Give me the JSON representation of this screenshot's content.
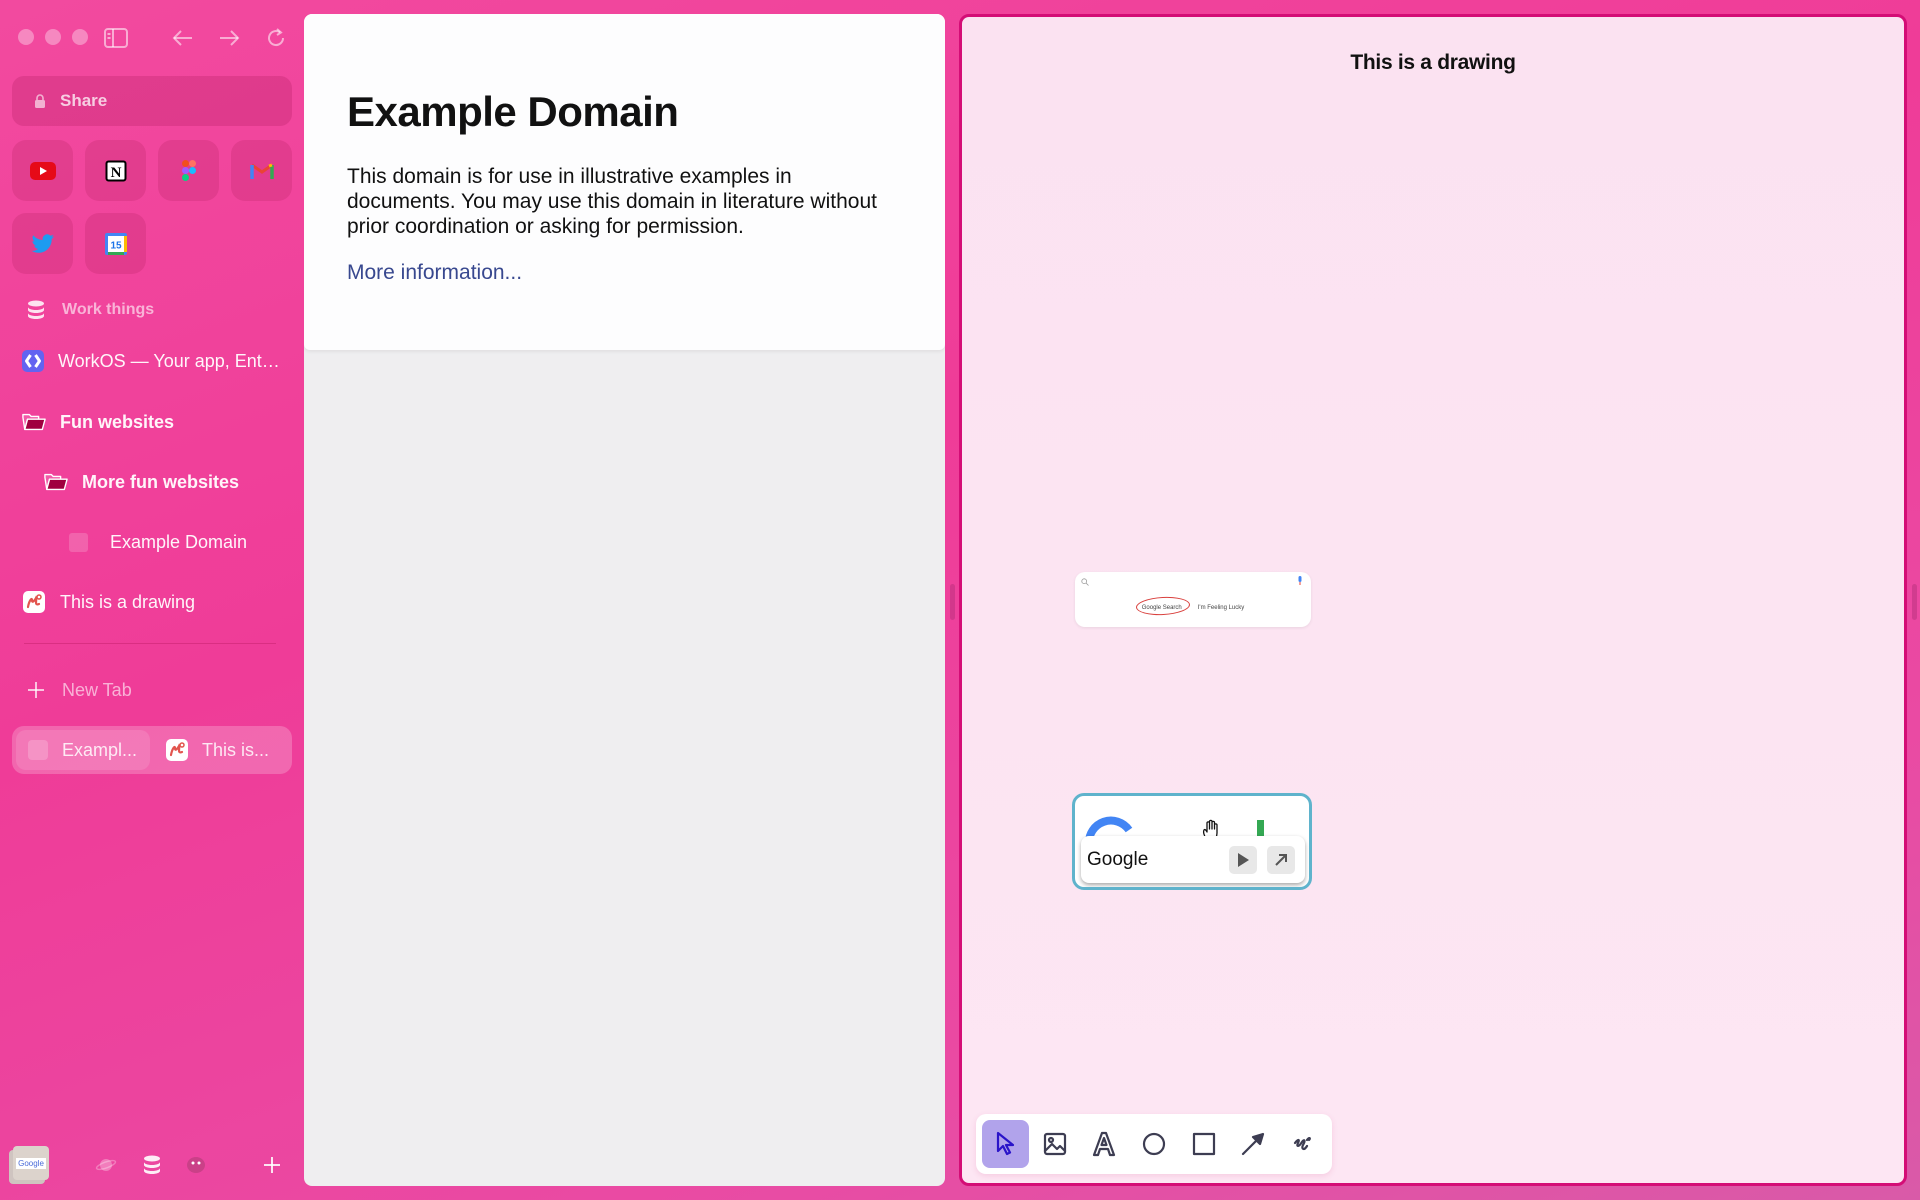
{
  "window": {
    "nav": {
      "back": "back-arrow",
      "forward": "forward-arrow",
      "reload": "reload"
    }
  },
  "sidebar": {
    "url_label": "Share",
    "favorites": [
      {
        "name": "YouTube",
        "icon": "youtube-icon"
      },
      {
        "name": "Notion",
        "icon": "notion-icon"
      },
      {
        "name": "Figma",
        "icon": "figma-icon"
      },
      {
        "name": "Gmail",
        "icon": "gmail-icon"
      },
      {
        "name": "Twitter",
        "icon": "twitter-icon"
      },
      {
        "name": "Google Calendar",
        "icon": "calendar-icon",
        "badge": "15"
      }
    ],
    "section_title": "Work things",
    "items": [
      {
        "label": "WorkOS — Your app, Enterprise Ready",
        "type": "tab"
      },
      {
        "label": "Fun websites",
        "type": "folder"
      },
      {
        "label": "More fun websites",
        "type": "folder"
      },
      {
        "label": "Example Domain",
        "type": "tab"
      },
      {
        "label": "This is a drawing",
        "type": "tab"
      }
    ],
    "new_tab": "New Tab",
    "split_tabs": [
      {
        "label": "Exampl..."
      },
      {
        "label": "This is..."
      }
    ],
    "bottom": {
      "preview_label": "Google"
    }
  },
  "left_pane": {
    "heading": "Example Domain",
    "paragraph": "This domain is for use in illustrative examples in documents. You may use this domain in literature without prior coordination or asking for permission.",
    "link": "More information..."
  },
  "right_pane": {
    "title": "This is a drawing",
    "snippet1": {
      "button1": "Google Search",
      "button2": "I'm Feeling Lucky"
    },
    "snippet2": {
      "label": "Google"
    },
    "tools": [
      "select",
      "image",
      "text",
      "ellipse",
      "rectangle",
      "arrow",
      "draw"
    ],
    "active_tool": "select",
    "accent": "#d40d76",
    "active_tool_color": "#b1a3eb"
  }
}
